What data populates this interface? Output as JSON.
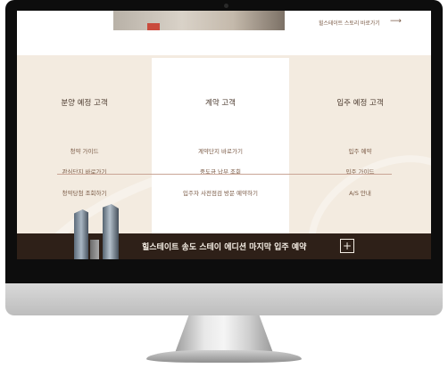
{
  "header": {
    "story_link": "힐스테이트 스토리 바로가기",
    "story_arrow": "⟶"
  },
  "columns": [
    {
      "title": "분양 예정 고객",
      "items": [
        "청약 가이드",
        "관심단지 바로가기",
        "청약당첨 조회하기"
      ]
    },
    {
      "title": "계약 고객",
      "items": [
        "계약단지 바로가기",
        "중도금 납부 조회",
        "입주자 사전점검 방문 예약하기"
      ]
    },
    {
      "title": "입주 예정 고객",
      "items": [
        "입주 예약",
        "입주 가이드",
        "A/S 안내"
      ]
    }
  ],
  "bottom_bar": {
    "text": "힐스테이트 송도 스테이 에디션   마지막 입주 예약",
    "plus": "+"
  },
  "colors": {
    "bar_bg": "#2e2018",
    "panel_bg": "#f3ebe0",
    "divider": "#c9a596"
  }
}
